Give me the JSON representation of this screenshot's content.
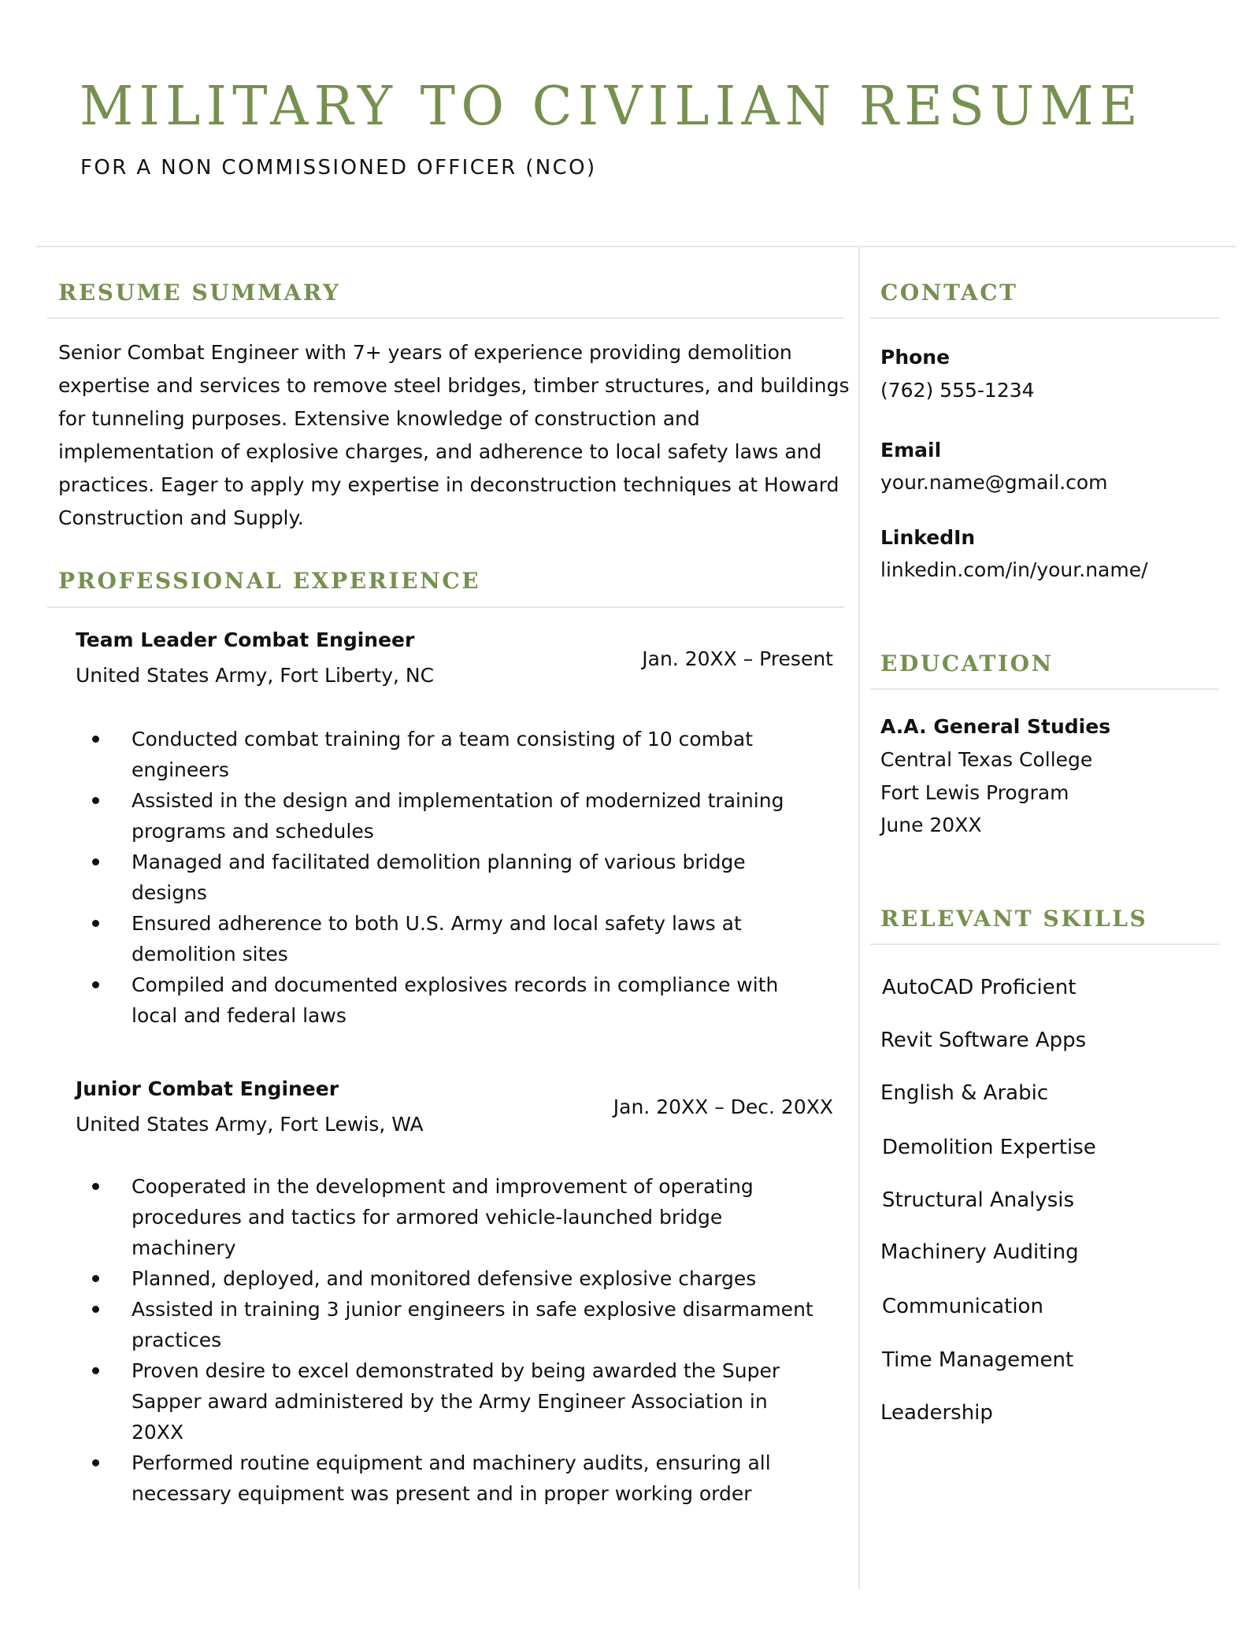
{
  "header": {
    "title": "MILITARY TO CIVILIAN RESUME",
    "subtitle": "FOR A NON COMMISSIONED OFFICER (NCO)"
  },
  "colors": {
    "accent": "#76904f",
    "text": "#111111",
    "rule": "#e6e6e6"
  },
  "summary": {
    "heading": "RESUME SUMMARY",
    "text": "Senior Combat Engineer with 7+ years of experience providing demolition expertise and services to remove steel bridges, timber structures, and buildings for tunneling purposes. Extensive knowledge of construction and implementation of explosive charges, and adherence to local safety laws and practices. Eager to apply my expertise in deconstruction techniques at Howard Construction and Supply."
  },
  "experience": {
    "heading": "PROFESSIONAL EXPERIENCE",
    "jobs": [
      {
        "title": "Team Leader Combat Engineer",
        "company": "United States Army, Fort Liberty, NC",
        "dates": "Jan. 20XX – Present",
        "bullets": [
          "Conducted combat training for a team consisting of 10 combat engineers",
          "Assisted in the design and implementation of modernized training programs and schedules",
          "Managed and facilitated demolition planning of various bridge designs",
          "Ensured adherence to both U.S. Army and local safety laws at demolition sites",
          "Compiled and documented explosives records in compliance with local and federal laws"
        ]
      },
      {
        "title": "Junior Combat Engineer",
        "company": "United States Army, Fort Lewis, WA",
        "dates": "Jan. 20XX – Dec. 20XX",
        "bullets": [
          "Cooperated in the development and improvement of operating procedures and tactics for armored vehicle-launched bridge machinery",
          "Planned, deployed, and monitored defensive explosive charges",
          "Assisted in training 3 junior engineers in safe explosive disarmament practices",
          "Proven desire to excel demonstrated by being awarded the Super Sapper award administered by the Army Engineer Association in 20XX",
          "Performed routine equipment and machinery audits, ensuring all necessary equipment was present and in proper working order"
        ]
      }
    ]
  },
  "contact": {
    "heading": "CONTACT",
    "items": [
      {
        "label": "Phone",
        "value": "(762) 555-1234"
      },
      {
        "label": "Email",
        "value": "your.name@gmail.com"
      },
      {
        "label": "LinkedIn",
        "value": "linkedin.com/in/your.name/"
      }
    ]
  },
  "education": {
    "heading": "EDUCATION",
    "degree": "A.A. General Studies",
    "school": "Central Texas College",
    "program": "Fort Lewis Program",
    "date": "June 20XX"
  },
  "skills": {
    "heading": "RELEVANT SKILLS",
    "items": [
      "AutoCAD Proficient",
      "Revit Software Apps",
      "English & Arabic",
      "Demolition Expertise",
      "Structural Analysis",
      "Machinery Auditing",
      "Communication",
      "Time Management",
      "Leadership"
    ]
  }
}
